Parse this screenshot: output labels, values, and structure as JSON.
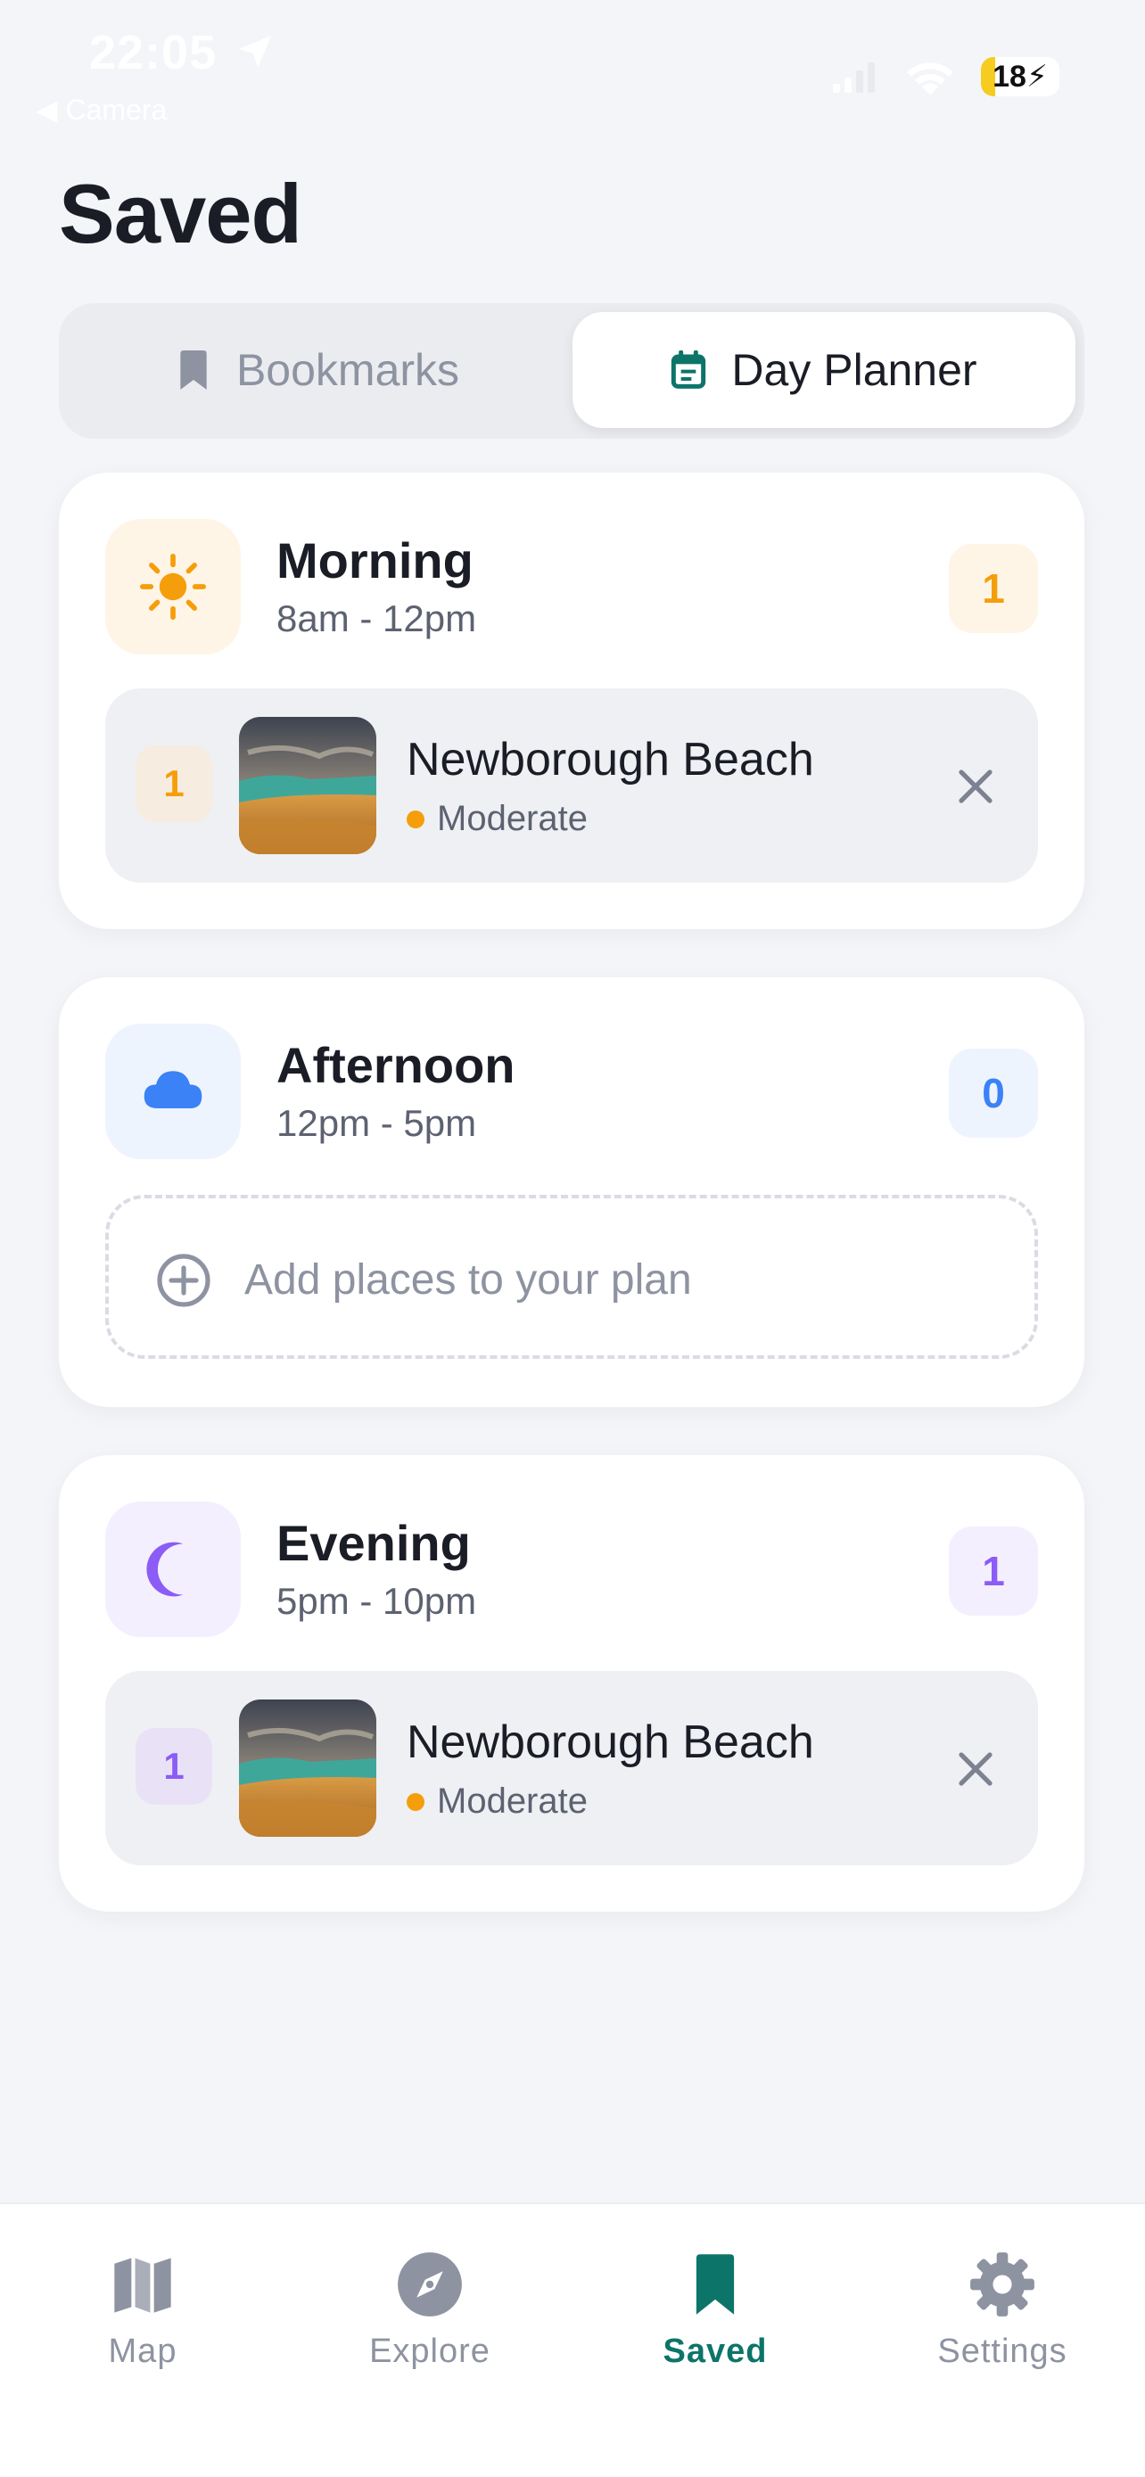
{
  "status_bar": {
    "time": "22:05",
    "back_label": "◀ Camera",
    "battery": "18"
  },
  "page": {
    "title": "Saved"
  },
  "tabs": [
    {
      "label": "Bookmarks",
      "icon": "bookmark-icon",
      "active": false
    },
    {
      "label": "Day Planner",
      "icon": "calendar-icon",
      "active": true
    }
  ],
  "periods": [
    {
      "name": "Morning",
      "time_range": "8am - 12pm",
      "count": "1",
      "icon": "sun-icon",
      "color": "#f59e0b",
      "places": [
        {
          "index": "1",
          "name": "Newborough Beach",
          "difficulty": "Moderate"
        }
      ]
    },
    {
      "name": "Afternoon",
      "time_range": "12pm - 5pm",
      "count": "0",
      "icon": "cloud-icon",
      "color": "#3b82f6",
      "empty_label": "Add places to your plan"
    },
    {
      "name": "Evening",
      "time_range": "5pm - 10pm",
      "count": "1",
      "icon": "moon-icon",
      "color": "#8b5cf6",
      "places": [
        {
          "index": "1",
          "name": "Newborough Beach",
          "difficulty": "Moderate"
        }
      ]
    }
  ],
  "bottom_nav": [
    {
      "label": "Map",
      "icon": "map-icon",
      "active": false
    },
    {
      "label": "Explore",
      "icon": "compass-icon",
      "active": false
    },
    {
      "label": "Saved",
      "icon": "bookmark-icon",
      "active": true
    },
    {
      "label": "Settings",
      "icon": "gear-icon",
      "active": false
    }
  ],
  "colors": {
    "accent": "#0d7469",
    "morning": "#f59e0b",
    "afternoon": "#3b82f6",
    "evening": "#8b5cf6",
    "moderate_dot": "#f59e0b"
  }
}
